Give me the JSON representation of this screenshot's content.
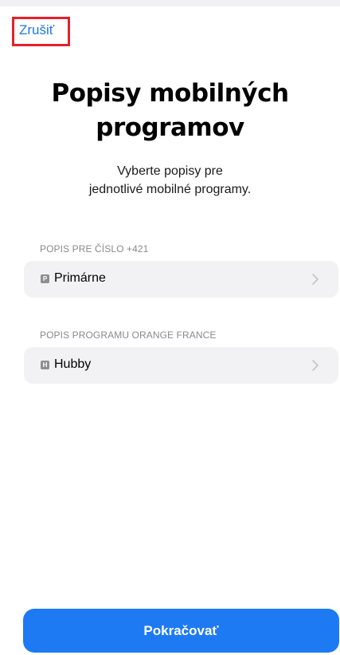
{
  "nav": {
    "cancel_label": "Zrušiť"
  },
  "header": {
    "title_line1": "Popisy mobilných",
    "title_line2": "programov",
    "subtitle_line1": "Vyberte popisy pre",
    "subtitle_line2": "jednotlivé mobilné programy."
  },
  "sections": [
    {
      "label": "POPIS PRE ČÍSLO +421",
      "value": "Primárne",
      "badge": "P",
      "icon": "chevron-right-icon"
    },
    {
      "label": "POPIS PROGRAMU ORANGE FRANCE",
      "value": "Hubby",
      "badge": "H",
      "icon": "chevron-right-icon"
    }
  ],
  "footer": {
    "continue_label": "Pokračovať"
  },
  "colors": {
    "accent": "#1d7af3",
    "highlight_box": "#e6202b",
    "row_bg": "#f2f2f4",
    "section_label": "#8a8a8e"
  }
}
